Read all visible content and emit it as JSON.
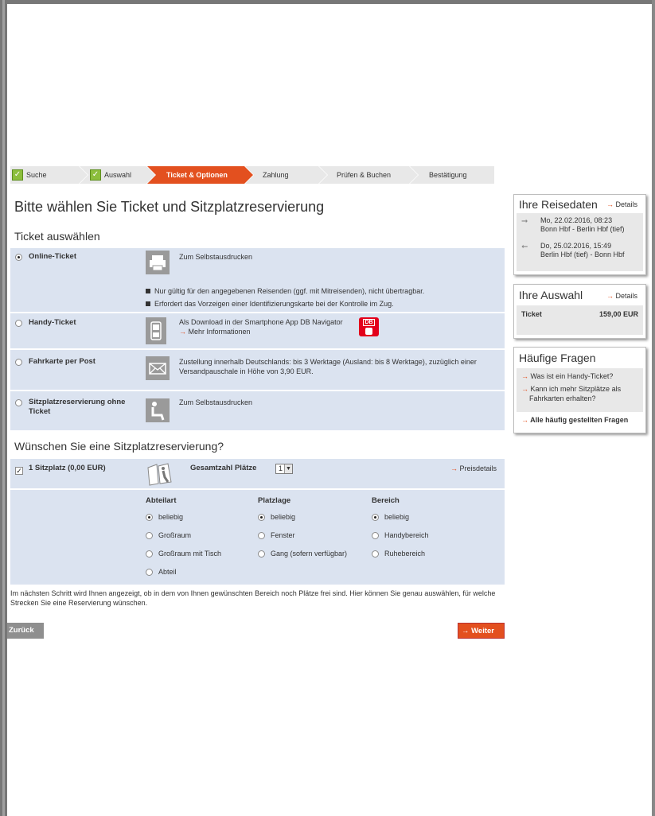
{
  "steps": [
    {
      "label": "Suche",
      "done": true
    },
    {
      "label": "Auswahl",
      "done": true
    },
    {
      "label": "Ticket & Optionen",
      "active": true
    },
    {
      "label": "Zahlung"
    },
    {
      "label": "Prüfen & Buchen"
    },
    {
      "label": "Bestätigung"
    }
  ],
  "page_title": "Bitte wählen Sie Ticket und Sitzplatzreservierung",
  "ticket_section_title": "Ticket auswählen",
  "tickets": {
    "online": {
      "label": "Online-Ticket",
      "selected": true,
      "desc": "Zum Selbstausdrucken",
      "notes": [
        "Nur gültig für den angegebenen Reisenden (ggf. mit Mitreisenden), nicht übertragbar.",
        "Erfordert das Vorzeigen einer Identifizierungskarte bei der Kontrolle im Zug."
      ]
    },
    "handy": {
      "label": "Handy-Ticket",
      "desc": "Als Download in der Smartphone App DB Navigator",
      "more": "Mehr Informationen",
      "db_logo": "DB"
    },
    "post": {
      "label": "Fahrkarte per Post",
      "desc": "Zustellung innerhalb Deutschlands: bis 3 Werktage (Ausland: bis 8 Werktage), zuzüglich einer Versandpauschale in Höhe von 3,90 EUR."
    },
    "seat_only": {
      "label": "Sitzplatzreservierung ohne Ticket",
      "desc": "Zum Selbstausdrucken"
    }
  },
  "reservation_title": "Wünschen Sie eine Sitzplatzreservierung?",
  "reservation": {
    "checkbox_label": "1 Sitzplatz (0,00 EUR)",
    "checked": true,
    "total_label": "Gesamtzahl Plätze",
    "total_value": "1",
    "price_details": "Preisdetails",
    "col_abteilart": {
      "title": "Abteilart",
      "options": [
        "beliebig",
        "Großraum",
        "Großraum mit Tisch",
        "Abteil"
      ],
      "selected": 0
    },
    "col_platzlage": {
      "title": "Platzlage",
      "options": [
        "beliebig",
        "Fenster",
        "Gang (sofern verfügbar)"
      ],
      "selected": 0
    },
    "col_bereich": {
      "title": "Bereich",
      "options": [
        "beliebig",
        "Handybereich",
        "Ruhebereich"
      ],
      "selected": 0
    }
  },
  "info_text": "Im nächsten Schritt wird Ihnen angezeigt, ob in dem von Ihnen gewünschten Bereich noch Plätze frei sind. Hier können Sie genau auswählen, für welche Strecken Sie eine Reservierung wünschen.",
  "buttons": {
    "back": "Zurück",
    "next": "Weiter"
  },
  "sidebar": {
    "reisedaten": {
      "title": "Ihre Reisedaten",
      "details": "Details",
      "outbound": {
        "line1": "Mo, 22.02.2016, 08:23",
        "line2": "Bonn Hbf - Berlin Hbf (tief)"
      },
      "return": {
        "line1": "Do, 25.02.2016, 15:49",
        "line2": "Berlin Hbf (tief) - Bonn Hbf"
      }
    },
    "auswahl": {
      "title": "Ihre Auswahl",
      "details": "Details",
      "ticket_label": "Ticket",
      "ticket_price": "159,00 EUR"
    },
    "faq": {
      "title": "Häufige Fragen",
      "q1": "Was ist ein Handy-Ticket?",
      "q2": "Kann ich mehr Sitzplätze als Fahrkarten erhalten?",
      "all": "Alle häufig gestellten Fragen"
    }
  },
  "colors": {
    "accent": "#e3501f",
    "panel": "#dbe3f0",
    "check_green": "#8cbe3c"
  }
}
